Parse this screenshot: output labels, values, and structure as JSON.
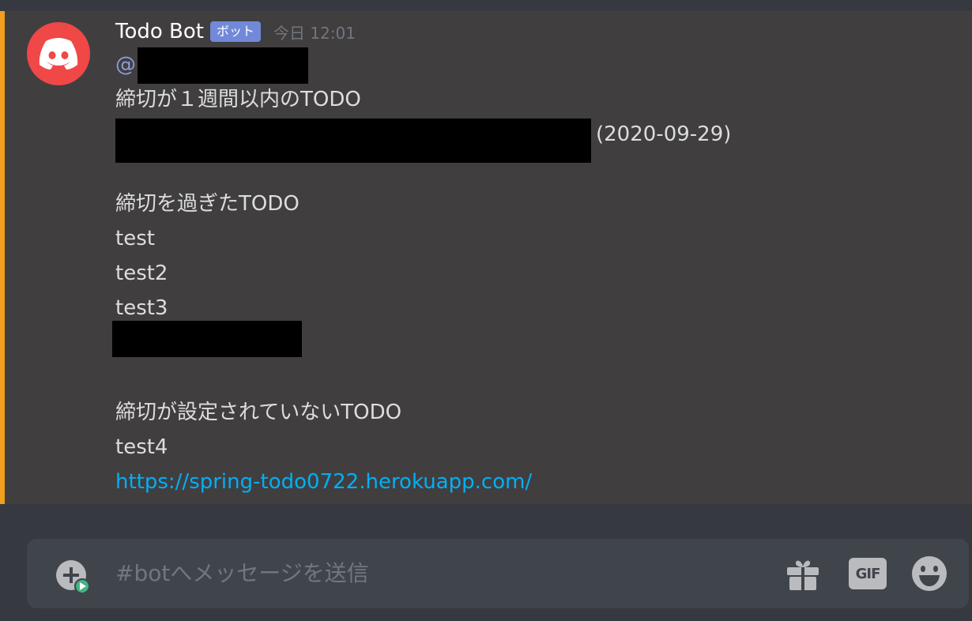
{
  "message": {
    "username": "Todo Bot",
    "bot_tag": "ボット",
    "timestamp": "今日 12:01",
    "mention_prefix": "@",
    "lines": {
      "within_week_heading": "締切が１週間以内のTODO",
      "within_week_date": "(2020-09-29)",
      "overdue_heading": "締切を過ぎたTODO",
      "overdue_item_1": "test",
      "overdue_item_2": "test2",
      "overdue_item_3": "test3",
      "no_deadline_heading": "締切が設定されていないTODO",
      "no_deadline_item_1": "test4",
      "link": "https://spring-todo0722.herokuapp.com/"
    }
  },
  "composer": {
    "placeholder": "#botへメッセージを送信",
    "gif_label": "GIF"
  },
  "icons": [
    "discord-logo-icon",
    "attach-plus-icon",
    "gift-icon",
    "emoji-icon"
  ],
  "colors": {
    "accent": "#f0a01c",
    "bot_tag": "#7289da",
    "link": "#00b0f4",
    "avatar": "#f04747"
  }
}
